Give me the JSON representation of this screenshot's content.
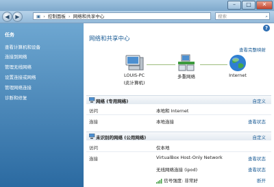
{
  "address": {
    "segments": [
      "控制面板",
      "网络和共享中心"
    ],
    "search_placeholder": "搜索"
  },
  "window_buttons": {
    "minimize": "–",
    "maximize": "□",
    "close": "✕"
  },
  "sidebar": {
    "heading": "任务",
    "items": [
      "查看计算机和设备",
      "连接到网络",
      "管理无线网络",
      "设置连接或网络",
      "管理网络连接",
      "诊断和修复"
    ]
  },
  "main": {
    "help": "?",
    "title": "网络和共享中心",
    "full_map_link": "查看完整映射",
    "map": {
      "computer_name": "LOUIS-PC",
      "computer_sub": "(此计算机)",
      "network_label": "多重网络",
      "internet_label": "Internet"
    },
    "section1": {
      "title": "网络 (专用网络)",
      "customize": "自定义",
      "rows": [
        {
          "label": "访问",
          "value": "本地和 Internet",
          "action": ""
        },
        {
          "label": "连接",
          "value": "本地连接",
          "action": "查看状态"
        }
      ]
    },
    "section2": {
      "title": "未识别的网络 (公用网络)",
      "customize": "自定义",
      "rows": [
        {
          "label": "访问",
          "value": "仅本地",
          "action": ""
        },
        {
          "label": "连接",
          "value": "VirtualBox Host-Only Network",
          "action": "查看状态"
        },
        {
          "label": "",
          "value": "无线网络连接 (ipod)",
          "action": "查看状态"
        },
        {
          "label": "",
          "value": "信号强度: 非常好",
          "action": "断开"
        }
      ]
    }
  }
}
